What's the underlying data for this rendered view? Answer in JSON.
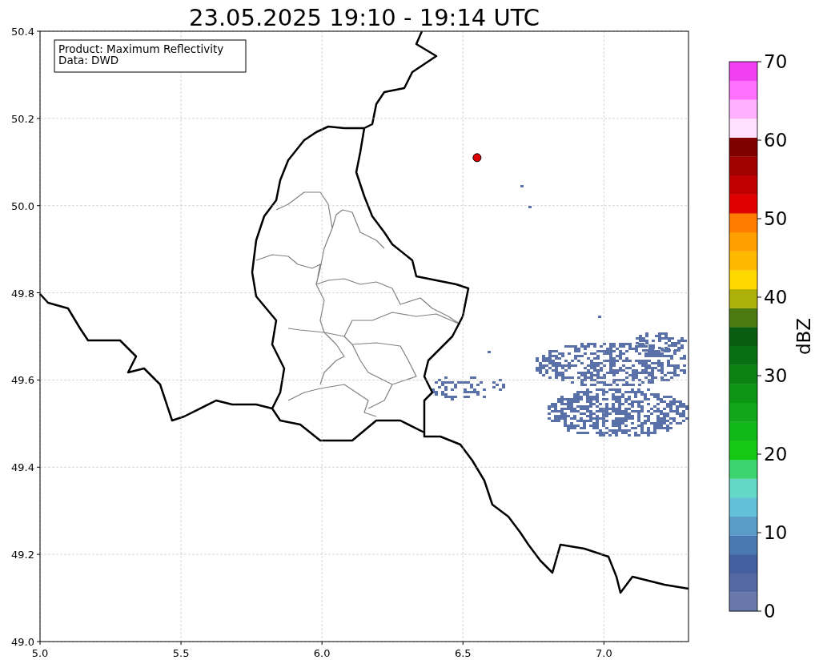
{
  "title": "23.05.2025 19:10 - 19:14 UTC",
  "info_box": {
    "lines": [
      "Product: Maximum Reflectivity",
      "Data: DWD"
    ]
  },
  "map": {
    "chart_data": {
      "type": "scatter",
      "grid": true,
      "x": [
        6.55
      ],
      "series": [
        {
          "color": "#e00000",
          "values": [
            50.11
          ]
        }
      ],
      "xlim": [
        5,
        7.3
      ],
      "ylim": [
        49,
        50.4
      ],
      "xticks": [
        {
          "value": 5,
          "label": "5.0"
        },
        {
          "value": 5.5,
          "label": "5.5"
        },
        {
          "value": 6,
          "label": "6.0"
        },
        {
          "value": 6.5,
          "label": "6.5"
        },
        {
          "value": 7,
          "label": "7.0"
        }
      ],
      "yticks": [
        {
          "value": 49,
          "label": "49.0"
        },
        {
          "value": 49.2,
          "label": "49.2"
        },
        {
          "value": 49.4,
          "label": "49.4"
        },
        {
          "value": 49.6,
          "label": "49.6"
        },
        {
          "value": 49.8,
          "label": "49.8"
        },
        {
          "value": 50,
          "label": "50.0"
        },
        {
          "value": 50.2,
          "label": "50.2"
        },
        {
          "value": 50.4,
          "label": "50.4"
        }
      ]
    }
  },
  "colorbar": {
    "label": "dBZ",
    "ticks": [
      "70",
      "60",
      "50",
      "40",
      "30",
      "20",
      "10",
      "0"
    ],
    "bins": [
      {
        "color": "#6878a8"
      },
      {
        "color": "#5468a4"
      },
      {
        "color": "#4460a0"
      },
      {
        "color": "#4a78b0"
      },
      {
        "color": "#5a9cc8"
      },
      {
        "color": "#64c0d8"
      },
      {
        "color": "#64d8c8"
      },
      {
        "color": "#3cd470"
      },
      {
        "color": "#14c814"
      },
      {
        "color": "#10b818"
      },
      {
        "color": "#10a818"
      },
      {
        "color": "#0e9414"
      },
      {
        "color": "#0a8214"
      },
      {
        "color": "#087010"
      },
      {
        "color": "#0a5c10"
      },
      {
        "color": "#4a7a10"
      },
      {
        "color": "#aeb00a"
      },
      {
        "color": "#ffd800"
      },
      {
        "color": "#ffb800"
      },
      {
        "color": "#ffa000"
      },
      {
        "color": "#ff7c00"
      },
      {
        "color": "#e00000"
      },
      {
        "color": "#c00000"
      },
      {
        "color": "#a00000"
      },
      {
        "color": "#800000"
      },
      {
        "color": "#ffe0ff"
      },
      {
        "color": "#ffb0ff"
      },
      {
        "color": "#ff70ff"
      },
      {
        "color": "#f040f0"
      }
    ]
  }
}
